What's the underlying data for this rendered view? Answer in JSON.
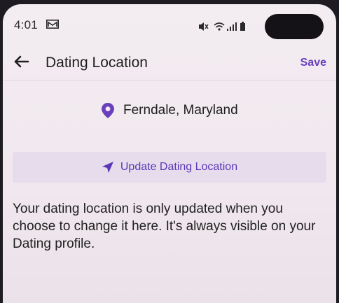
{
  "status_bar": {
    "time": "4:01",
    "icons": [
      "message-icon",
      "mute-icon",
      "wifi-icon",
      "signal-icon",
      "battery-icon"
    ]
  },
  "header": {
    "back_icon": "arrow-left-icon",
    "title": "Dating Location",
    "save_label": "Save"
  },
  "location": {
    "icon": "location-pin-icon",
    "name": "Ferndale, Maryland"
  },
  "update_button": {
    "icon": "navigation-arrow-icon",
    "label": "Update Dating Location"
  },
  "info": {
    "text": "Your dating location is only updated when you choose to change it here. It's always visible on your Dating profile."
  },
  "colors": {
    "accent": "#6a3fbd",
    "button_bg": "#e6dcec",
    "background": "#f2eaf0",
    "text": "#1f1f1f"
  }
}
